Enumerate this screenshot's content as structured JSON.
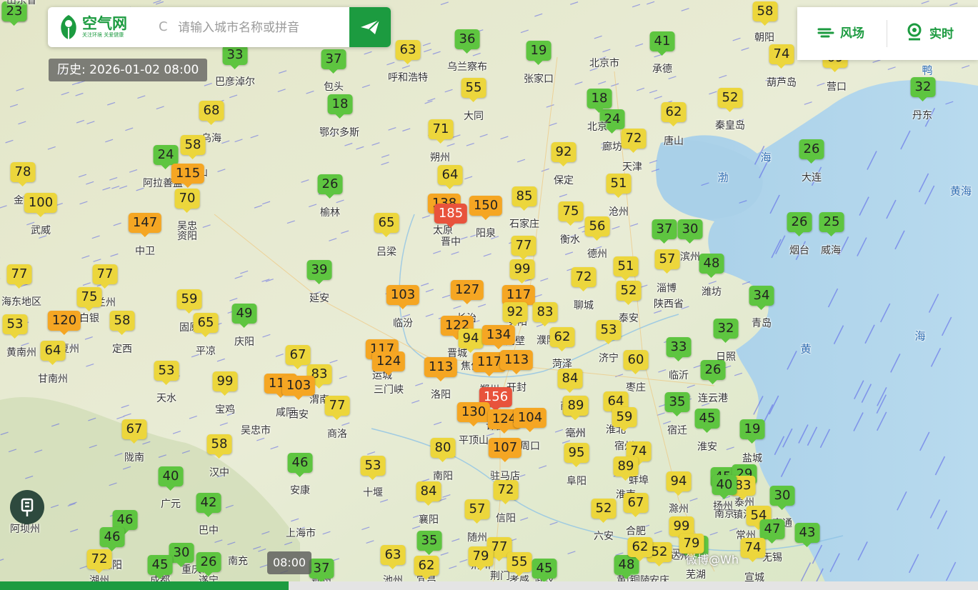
{
  "brand": {
    "name": "空气网",
    "slogan": "关注环境 关爱健康"
  },
  "search": {
    "placeholder": "请输入城市名称或拼音"
  },
  "history_label": "历史: 2026-01-02 08:00",
  "tools": {
    "wind": "风场",
    "realtime": "实时"
  },
  "timeline": {
    "time_label": "08:00",
    "progress": 0.295
  },
  "watermark": "微博@Wh",
  "colors": {
    "good": "#5ec540",
    "moderate": "#ecd63c",
    "light": "#f5a623",
    "medium": "#e8533c",
    "brand": "#1c9b40"
  },
  "sea_labels": [
    "渤",
    "海",
    "黄",
    "海",
    "黄海",
    "鸭"
  ],
  "cities": [
    {
      "name": "巴彦淖尔",
      "aqi": 33
    },
    {
      "name": "包头",
      "aqi": 37
    },
    {
      "name": "呼和浩特",
      "aqi": 63
    },
    {
      "name": "乌兰察布",
      "aqi": 36
    },
    {
      "name": "张家口",
      "aqi": 19
    },
    {
      "name": "北京市",
      "aqi": null
    },
    {
      "name": "承德",
      "aqi": 41
    },
    {
      "name": "朝阳",
      "aqi": 58
    },
    {
      "name": "葫芦岛",
      "aqi": 74
    },
    {
      "name": "营口",
      "aqi": 69
    },
    {
      "name": "丹东",
      "aqi": 32
    },
    {
      "name": "鄂尔多斯",
      "aqi": 18
    },
    {
      "name": "大同",
      "aqi": 55
    },
    {
      "name": "乌海",
      "aqi": 68
    },
    {
      "name": "阿拉善盟",
      "aqi": 24
    },
    {
      "name": "石嘴山",
      "aqi": 58
    },
    {
      "name": "银川",
      "aqi": 115
    },
    {
      "name": "吴忠",
      "aqi": 70
    },
    {
      "name": "朔州",
      "aqi": 71
    },
    {
      "name": "廊坊",
      "aqi": 24
    },
    {
      "name": "北京",
      "aqi": 18
    },
    {
      "name": "天津",
      "aqi": 72
    },
    {
      "name": "唐山",
      "aqi": 62
    },
    {
      "name": "秦皇岛",
      "aqi": 52
    },
    {
      "name": "大连",
      "aqi": 26
    },
    {
      "name": "保定",
      "aqi": 92
    },
    {
      "name": "忻州",
      "aqi": 64
    },
    {
      "name": "榆林",
      "aqi": 26
    },
    {
      "name": "金昌",
      "aqi": 78
    },
    {
      "name": "武威",
      "aqi": 100
    },
    {
      "name": "中卫",
      "aqi": 147
    },
    {
      "name": "太原",
      "aqi": 138
    },
    {
      "name": "晋中",
      "aqi": 185
    },
    {
      "name": "阳泉",
      "aqi": 150
    },
    {
      "name": "石家庄",
      "aqi": 85
    },
    {
      "name": "沧州",
      "aqi": 51
    },
    {
      "name": "衡水",
      "aqi": 75
    },
    {
      "name": "德州",
      "aqi": 56
    },
    {
      "name": "东营",
      "aqi": 37
    },
    {
      "name": "滨州",
      "aqi": 30
    },
    {
      "name": "烟台",
      "aqi": 26
    },
    {
      "name": "威海",
      "aqi": 25
    },
    {
      "name": "吕梁",
      "aqi": 65
    },
    {
      "name": "邢台",
      "aqi": 77
    },
    {
      "name": "淄博",
      "aqi": 57
    },
    {
      "name": "潍坊",
      "aqi": 48
    },
    {
      "name": "延安",
      "aqi": 39
    },
    {
      "name": "邯郸",
      "aqi": 99
    },
    {
      "name": "聊城",
      "aqi": 72
    },
    {
      "name": "济南",
      "aqi": 51
    },
    {
      "name": "海东地区",
      "aqi": 77
    },
    {
      "name": "兰州",
      "aqi": 77
    },
    {
      "name": "白银",
      "aqi": 75
    },
    {
      "name": "临汾",
      "aqi": 103
    },
    {
      "name": "长治",
      "aqi": 127
    },
    {
      "name": "安阳",
      "aqi": 117
    },
    {
      "name": "泰安",
      "aqi": 52
    },
    {
      "name": "青岛",
      "aqi": 34
    },
    {
      "name": "固原",
      "aqi": 59
    },
    {
      "name": "庆阳",
      "aqi": 49
    },
    {
      "name": "鹤壁",
      "aqi": 92
    },
    {
      "name": "濮阳",
      "aqi": 83
    },
    {
      "name": "黄南州",
      "aqi": 53
    },
    {
      "name": "临夏州",
      "aqi": 120
    },
    {
      "name": "定西",
      "aqi": 58
    },
    {
      "name": "平凉",
      "aqi": 65
    },
    {
      "name": "晋城",
      "aqi": 122
    },
    {
      "name": "焦作",
      "aqi": 94
    },
    {
      "name": "新乡",
      "aqi": 134
    },
    {
      "name": "菏泽",
      "aqi": 62
    },
    {
      "name": "济宁",
      "aqi": 53
    },
    {
      "name": "日照",
      "aqi": 32
    },
    {
      "name": "甘南州",
      "aqi": 64
    },
    {
      "name": "运城",
      "aqi": 117
    },
    {
      "name": "三门峡",
      "aqi": 124
    },
    {
      "name": "洛阳",
      "aqi": 113
    },
    {
      "name": "郑州",
      "aqi": 117
    },
    {
      "name": "开封",
      "aqi": 113
    },
    {
      "name": "枣庄",
      "aqi": 60
    },
    {
      "name": "临沂",
      "aqi": 33
    },
    {
      "name": "连云港",
      "aqi": 26
    },
    {
      "name": "铜川",
      "aqi": 67
    },
    {
      "name": "渭南",
      "aqi": 83
    },
    {
      "name": "天水",
      "aqi": 53
    },
    {
      "name": "宝鸡",
      "aqi": 99
    },
    {
      "name": "咸阳",
      "aqi": 112
    },
    {
      "name": "西安",
      "aqi": 103
    },
    {
      "name": "商洛",
      "aqi": 77
    },
    {
      "name": "许昌",
      "aqi": 156
    },
    {
      "name": "商丘",
      "aqi": 84
    },
    {
      "name": "徐州",
      "aqi": 53
    },
    {
      "name": "平顶山",
      "aqi": 130
    },
    {
      "name": "漯河",
      "aqi": 124
    },
    {
      "name": "周口",
      "aqi": 104
    },
    {
      "name": "亳州",
      "aqi": 89
    },
    {
      "name": "淮北",
      "aqi": 64
    },
    {
      "name": "宿州",
      "aqi": 59
    },
    {
      "name": "宿迁",
      "aqi": 35
    },
    {
      "name": "淮安",
      "aqi": 45
    },
    {
      "name": "盐城",
      "aqi": 19
    },
    {
      "name": "陇南",
      "aqi": 67
    },
    {
      "name": "汉中",
      "aqi": 58
    },
    {
      "name": "南阳",
      "aqi": 80
    },
    {
      "name": "驻马店",
      "aqi": 107
    },
    {
      "name": "阜阳",
      "aqi": 95
    },
    {
      "name": "蚌埠",
      "aqi": 74
    },
    {
      "name": "淮南",
      "aqi": 89
    },
    {
      "name": "广元",
      "aqi": 40
    },
    {
      "name": "安康",
      "aqi": 46
    },
    {
      "name": "十堰",
      "aqi": 53
    },
    {
      "name": "襄阳",
      "aqi": 84
    },
    {
      "name": "信阳",
      "aqi": 72
    },
    {
      "name": "滁州",
      "aqi": 94
    },
    {
      "name": "扬州",
      "aqi": 45
    },
    {
      "name": "泰州",
      "aqi": 29
    },
    {
      "name": "镇江",
      "aqi": 83
    },
    {
      "name": "南京",
      "aqi": 40
    },
    {
      "name": "南通",
      "aqi": 30
    },
    {
      "name": "阿坝州",
      "aqi": null
    },
    {
      "name": "巴中",
      "aqi": 42
    },
    {
      "name": "绵阳",
      "aqi": 46
    },
    {
      "name": "德阳",
      "aqi": 46
    },
    {
      "name": "随州",
      "aqi": 57
    },
    {
      "name": "六安",
      "aqi": 52
    },
    {
      "name": "合肥",
      "aqi": 67
    },
    {
      "name": "马鞍山",
      "aqi": 99
    },
    {
      "name": "常州",
      "aqi": 54
    },
    {
      "name": "无锡",
      "aqi": 47
    },
    {
      "name": "苏州",
      "aqi": 43
    },
    {
      "name": "上海市",
      "aqi": 39
    },
    {
      "name": "重庆市",
      "aqi": null
    },
    {
      "name": "南充",
      "aqi": 30
    },
    {
      "name": "达州",
      "aqi": 30
    },
    {
      "name": "芜湖",
      "aqi": 79
    },
    {
      "name": "宣城",
      "aqi": 74
    },
    {
      "name": "湖州",
      "aqi": 72
    },
    {
      "name": "成都",
      "aqi": 45
    },
    {
      "name": "遂宁",
      "aqi": 26
    },
    {
      "name": "广安",
      "aqi": 35
    },
    {
      "name": "荆门",
      "aqi": 77
    },
    {
      "name": "孝感",
      "aqi": 55
    },
    {
      "name": "黄冈",
      "aqi": 48
    },
    {
      "name": "安庆",
      "aqi": 52
    },
    {
      "name": "铜陵",
      "aqi": 62
    },
    {
      "name": "池州",
      "aqi": 63
    },
    {
      "name": "宜昌",
      "aqi": 62
    },
    {
      "name": "荆州",
      "aqi": 79
    },
    {
      "name": "武汉",
      "aqi": 45
    },
    {
      "name": "鄂州",
      "aqi": 37
    },
    {
      "name": "资阳",
      "aqi": 23
    },
    {
      "name": "吴忠市",
      "aqi": null
    },
    {
      "name": "陕西省",
      "aqi": null
    },
    {
      "name": "山东省",
      "aqi": null
    }
  ]
}
